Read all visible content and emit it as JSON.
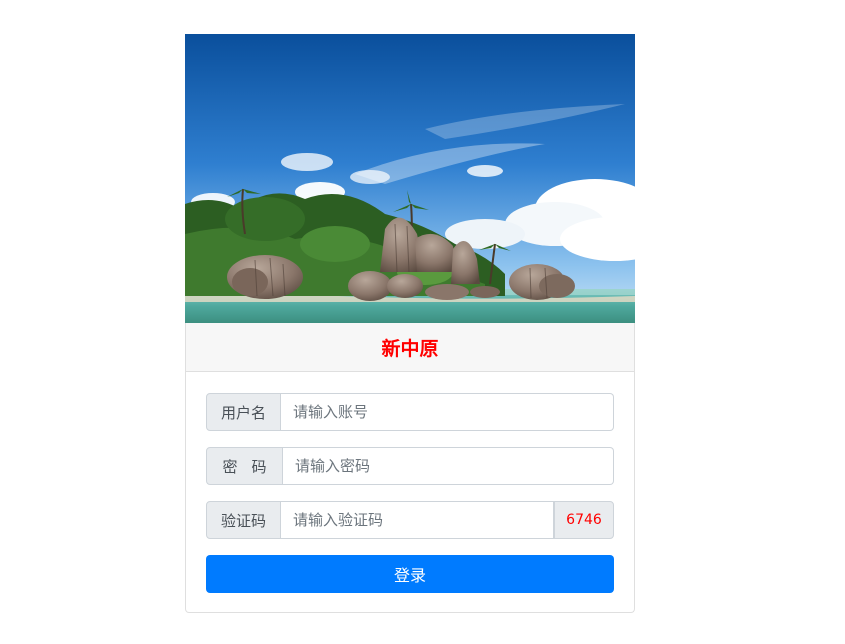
{
  "header": {
    "brand": "新中原"
  },
  "hero_image": {
    "subject": "tropical beach with granite boulders and palm trees"
  },
  "form": {
    "username": {
      "label": "用户名",
      "placeholder": "请输入账号",
      "value": ""
    },
    "password": {
      "label": "密码",
      "placeholder": "请输入密码",
      "value": ""
    },
    "captcha": {
      "label": "验证码",
      "placeholder": "请输入验证码",
      "value": "",
      "code": "6746"
    },
    "submit_label": "登录"
  },
  "colors": {
    "brand_text": "#ff0000",
    "primary_button": "#007bff",
    "captcha_text": "#ff0000",
    "header_background": "#f7f7f7"
  }
}
